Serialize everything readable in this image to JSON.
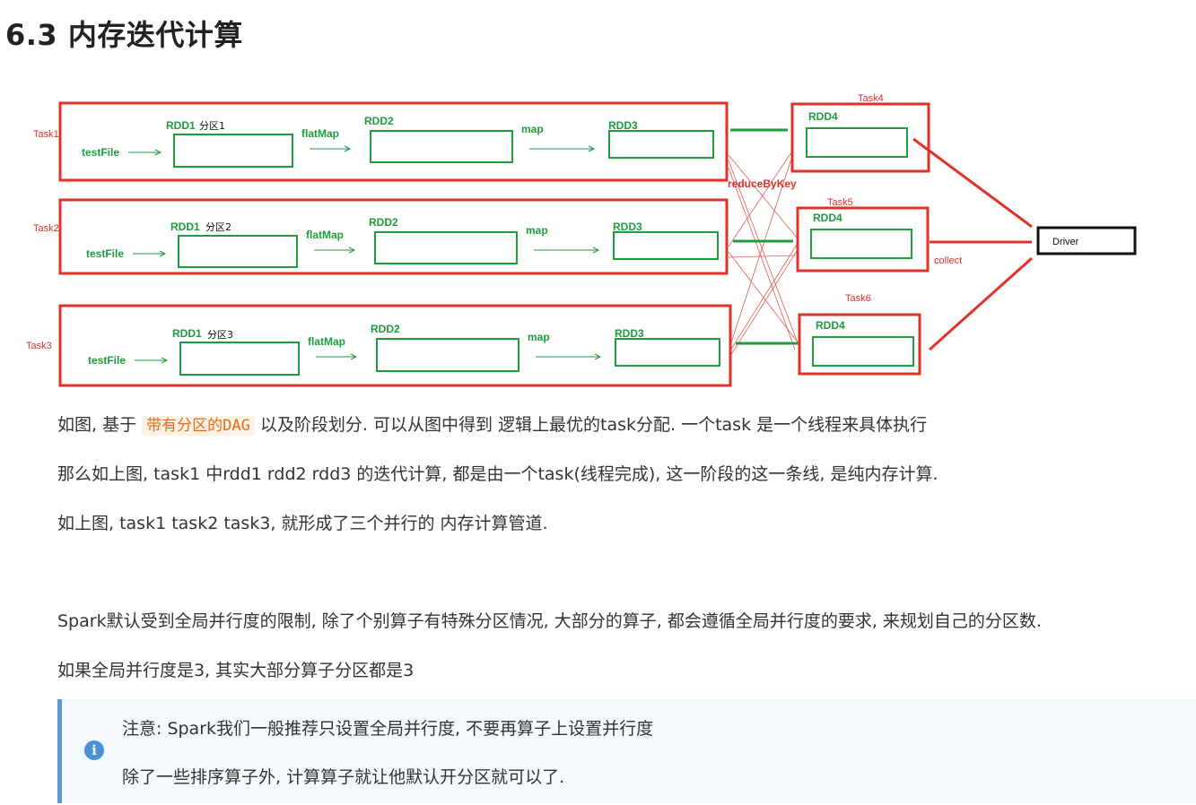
{
  "heading": "6.3 内存迭代计算",
  "diagram": {
    "tasks": [
      {
        "label": "Task1",
        "source": "testFile",
        "rdd1": "RDD1",
        "partition": "分区1",
        "op1": "flatMap",
        "rdd2": "RDD2",
        "op2": "map",
        "rdd3": "RDD3"
      },
      {
        "label": "Task2",
        "source": "testFile",
        "rdd1": "RDD1",
        "partition": "分区2",
        "op1": "flatMap",
        "rdd2": "RDD2",
        "op2": "map",
        "rdd3": "RDD3"
      },
      {
        "label": "Task3",
        "source": "testFile",
        "rdd1": "RDD1",
        "partition": "分区3",
        "op1": "flatMap",
        "rdd2": "RDD2",
        "op2": "map",
        "rdd3": "RDD3"
      }
    ],
    "shuffle_label": "reduceByKey",
    "reducers": [
      {
        "label": "Task4",
        "rdd": "RDD4"
      },
      {
        "label": "Task5",
        "rdd": "RDD4"
      },
      {
        "label": "Task6",
        "rdd": "RDD4"
      }
    ],
    "collect_label": "collect",
    "driver_label": "Driver",
    "colors": {
      "red": "#e0322a",
      "green": "#1e9c3e",
      "black": "#111111"
    }
  },
  "paragraphs": {
    "p1_before": "如图, 基于 ",
    "p1_code": "带有分区的DAG",
    "p1_after": " 以及阶段划分. 可以从图中得到 逻辑上最优的task分配. 一个task 是一个线程来具体执行",
    "p2": "那么如上图, task1 中rdd1 rdd2 rdd3 的迭代计算, 都是由一个task(线程完成), 这一阶段的这一条线, 是纯内存计算.",
    "p3": "如上图, task1 task2 task3, 就形成了三个并行的 内存计算管道.",
    "p4": "Spark默认受到全局并行度的限制, 除了个别算子有特殊分区情况, 大部分的算子, 都会遵循全局并行度的要求, 来规划自己的分区数.",
    "p5": "如果全局并行度是3, 其实大部分算子分区都是3"
  },
  "note": {
    "icon": "info-icon",
    "line1": "注意: Spark我们一般推荐只设置全局并行度, 不要再算子上设置并行度",
    "line2": "除了一些排序算子外, 计算算子就让他默认开分区就可以了."
  }
}
